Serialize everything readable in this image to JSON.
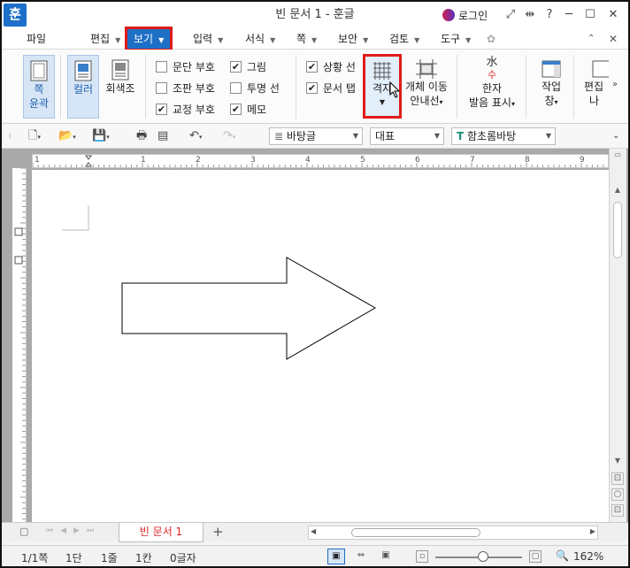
{
  "window": {
    "title": "빈 문서 1 - 훈글",
    "logo": "훈",
    "login": "로그인"
  },
  "menu": [
    "파일",
    "편집",
    "보기",
    "입력",
    "서식",
    "쪽",
    "보안",
    "검토",
    "도구"
  ],
  "ribbon": {
    "page_outline": "쪽\n윤곽",
    "color": "컬러",
    "grayscale": "회색조",
    "checks": [
      {
        "label": "문단 부호",
        "checked": false
      },
      {
        "label": "조판 부호",
        "checked": false
      },
      {
        "label": "교정 부호",
        "checked": true
      },
      {
        "label": "그림",
        "checked": true
      },
      {
        "label": "투명 선",
        "checked": false
      },
      {
        "label": "메모",
        "checked": true
      },
      {
        "label": "상황 선",
        "checked": true
      },
      {
        "label": "문서 탭",
        "checked": true
      }
    ],
    "grid": "격자",
    "object_move_line1": "개체 이동",
    "object_move_line2": "안내선",
    "hanja_line1": "한자",
    "hanja_line2": "발음 표시",
    "workspace_line1": "작업",
    "workspace_line2": "창",
    "edit_line1": "편집",
    "edit_line2": "나"
  },
  "toolbar": {
    "style": "바탕글",
    "outline": "대표",
    "font": "함초롬바탕"
  },
  "ruler_numbers": [
    "1",
    "1",
    "2",
    "3",
    "4",
    "5",
    "6",
    "7",
    "8",
    "9"
  ],
  "tab": {
    "doc_name": "빈 문서 1"
  },
  "status": {
    "page": "1/1쪽",
    "section": "1단",
    "line": "1줄",
    "column": "1칸",
    "chars": "0글자",
    "zoom": "162%"
  }
}
